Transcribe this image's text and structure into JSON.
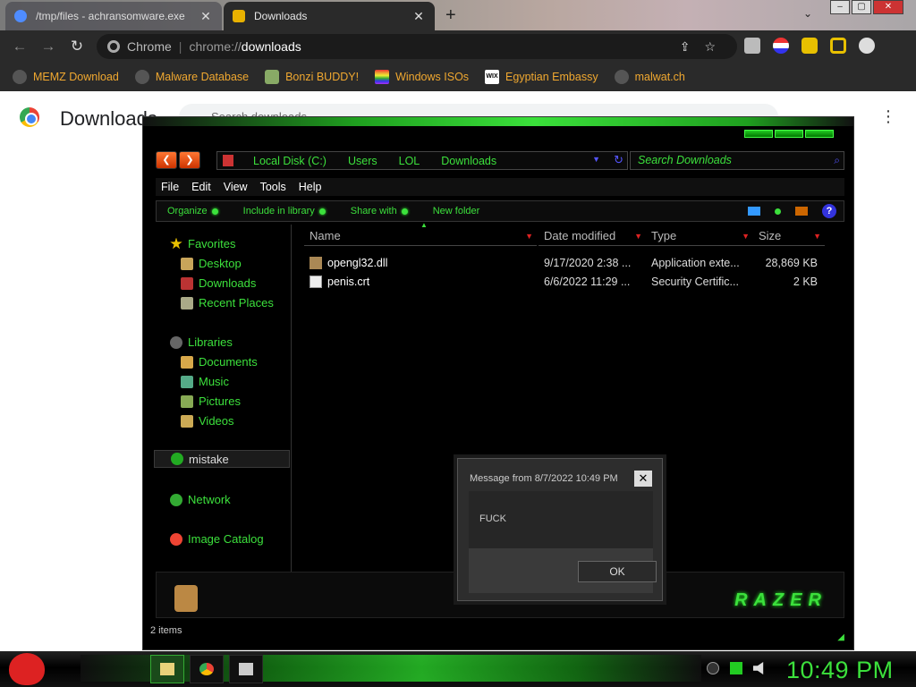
{
  "browser": {
    "tabs": [
      {
        "title": "/tmp/files - achransomware.exe",
        "active": false
      },
      {
        "title": "Downloads",
        "active": true
      }
    ],
    "new_tab": "+",
    "omnibox": {
      "site": "Chrome",
      "scheme": "chrome://",
      "host": "downloads"
    },
    "bookmarks": [
      {
        "label": "MEMZ Download"
      },
      {
        "label": "Malware Database"
      },
      {
        "label": "Bonzi BUDDY!"
      },
      {
        "label": "Windows ISOs"
      },
      {
        "label": "Egyptian Embassy"
      },
      {
        "label": "malwat.ch"
      }
    ],
    "page_title": "Downloads",
    "search_placeholder": "Search downloads"
  },
  "explorer": {
    "breadcrumbs": [
      "Local Disk (C:)",
      "Users",
      "LOL",
      "Downloads"
    ],
    "search_placeholder": "Search Downloads",
    "menu": [
      "File",
      "Edit",
      "View",
      "Tools",
      "Help"
    ],
    "commands": [
      "Organize",
      "Include in library",
      "Share with",
      "New folder"
    ],
    "nav": {
      "favorites": "Favorites",
      "favorites_items": [
        "Desktop",
        "Downloads",
        "Recent Places"
      ],
      "libraries": "Libraries",
      "libraries_items": [
        "Documents",
        "Music",
        "Pictures",
        "Videos"
      ],
      "user": "mistake",
      "network": "Network",
      "image_catalog": "Image Catalog"
    },
    "columns": [
      "Name",
      "Date modified",
      "Type",
      "Size"
    ],
    "files": [
      {
        "name": "opengl32.dll",
        "date": "9/17/2020 2:38 ...",
        "type": "Application exte...",
        "size": "28,869 KB",
        "icon": "dll-icon"
      },
      {
        "name": "penis.crt",
        "date": "6/6/2022 11:29 ...",
        "type": "Security Certific...",
        "size": "2 KB",
        "icon": "certificate-icon"
      }
    ],
    "logo_text": "RAZER",
    "status": "2 items"
  },
  "dialog": {
    "title": "Message from  8/7/2022 10:49 PM",
    "body": "FUCK",
    "ok_label": "OK",
    "close": "✕"
  },
  "taskbar": {
    "clock": "10:49 PM"
  },
  "colors": {
    "accent_green": "#3ce03c",
    "chrome_dark": "#2a2a2a",
    "bookmark_text": "#f0a830"
  }
}
